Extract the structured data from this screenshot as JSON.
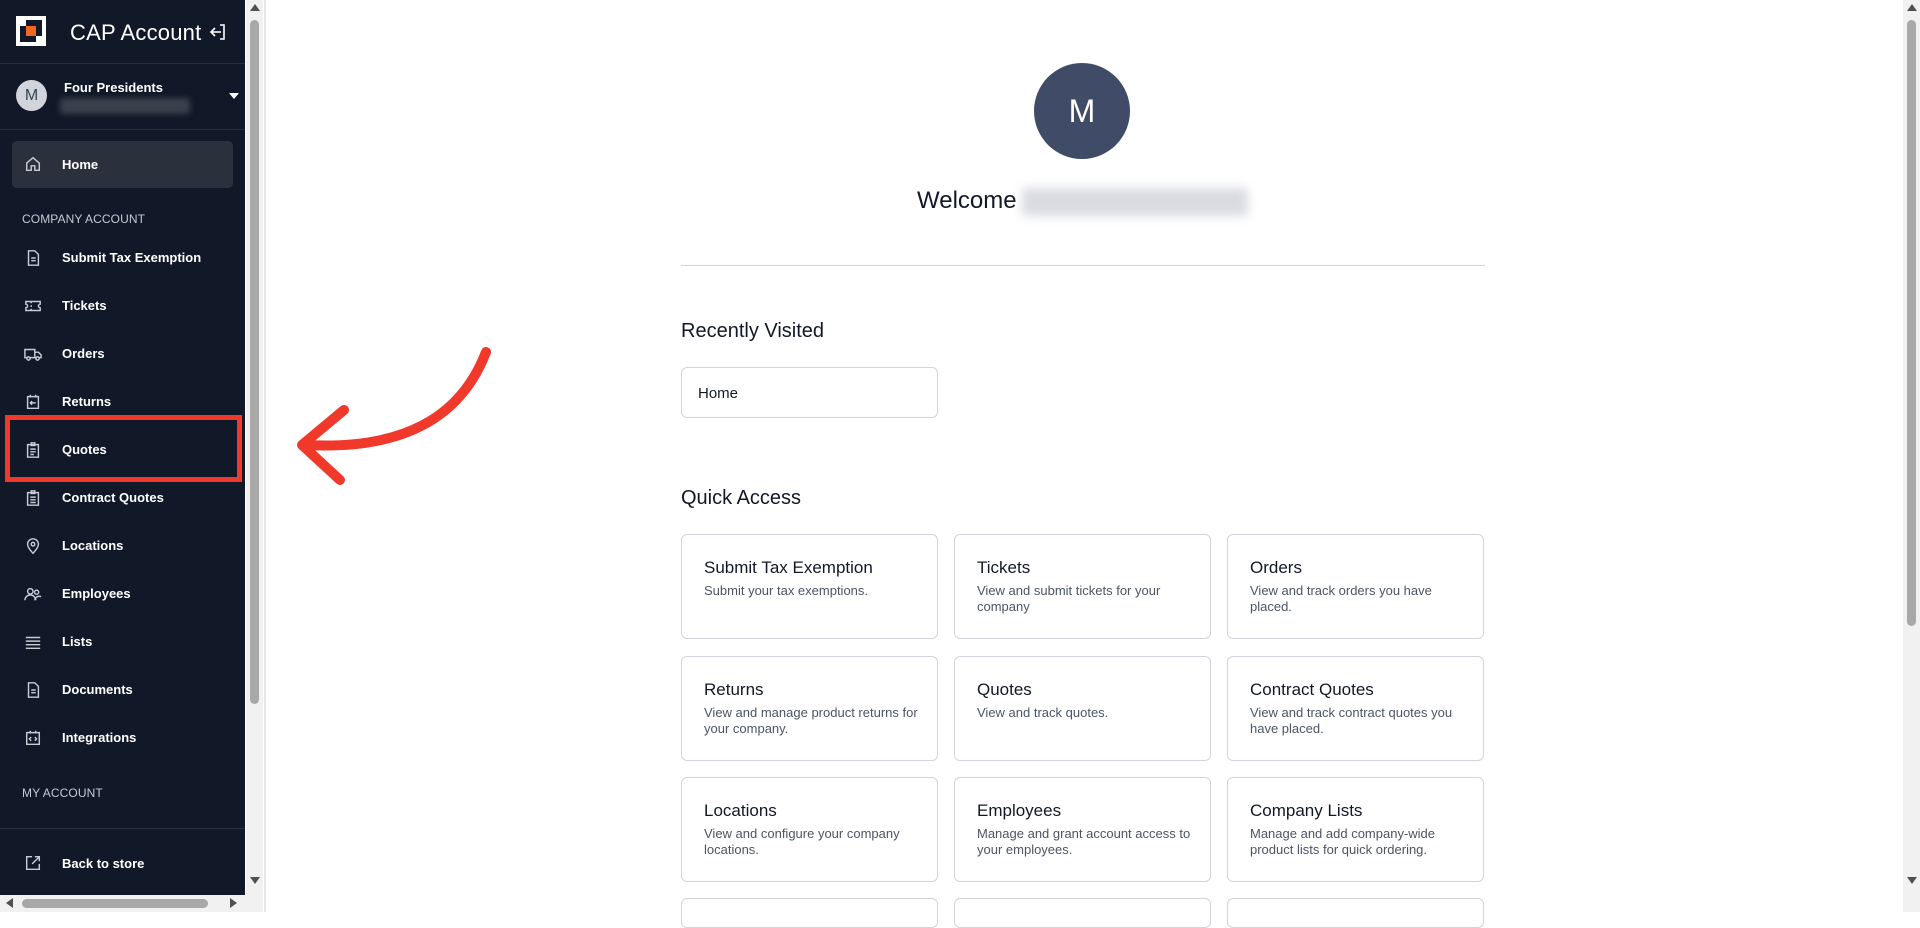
{
  "app": {
    "title": "CAP Account"
  },
  "account": {
    "avatar_initial": "M",
    "name": "Four Presidents"
  },
  "sidebar": {
    "home_label": "Home",
    "company_section": "COMPANY ACCOUNT",
    "items": [
      {
        "label": "Submit Tax Exemption",
        "icon": "document-icon"
      },
      {
        "label": "Tickets",
        "icon": "ticket-icon"
      },
      {
        "label": "Orders",
        "icon": "truck-icon"
      },
      {
        "label": "Returns",
        "icon": "return-icon"
      },
      {
        "label": "Quotes",
        "icon": "clipboard-icon"
      },
      {
        "label": "Contract Quotes",
        "icon": "clipboard-list-icon"
      },
      {
        "label": "Locations",
        "icon": "map-pin-icon"
      },
      {
        "label": "Employees",
        "icon": "users-icon"
      },
      {
        "label": "Lists",
        "icon": "list-icon"
      },
      {
        "label": "Documents",
        "icon": "file-icon"
      },
      {
        "label": "Integrations",
        "icon": "code-box-icon"
      }
    ],
    "my_account_section": "MY ACCOUNT",
    "back_label": "Back to store"
  },
  "main": {
    "avatar_initial": "M",
    "welcome": "Welcome",
    "recently_visited_title": "Recently Visited",
    "recent": [
      "Home"
    ],
    "quick_access_title": "Quick Access",
    "cards": [
      {
        "title": "Submit Tax Exemption",
        "desc": "Submit your tax exemptions."
      },
      {
        "title": "Tickets",
        "desc": "View and submit tickets for your company"
      },
      {
        "title": "Orders",
        "desc": "View and track orders you have placed."
      },
      {
        "title": "Returns",
        "desc": "View and manage product returns for your company."
      },
      {
        "title": "Quotes",
        "desc": "View and track quotes."
      },
      {
        "title": "Contract Quotes",
        "desc": "View and track contract quotes you have placed."
      },
      {
        "title": "Locations",
        "desc": "View and configure your company locations."
      },
      {
        "title": "Employees",
        "desc": "Manage and grant account access to your employees."
      },
      {
        "title": "Company Lists",
        "desc": "Manage and add company-wide product lists for quick ordering."
      }
    ]
  },
  "colors": {
    "sidebar_bg": "#111827",
    "active_item_bg": "#2a313d",
    "highlight": "#f0382b",
    "avatar_bg": "#3f4b67",
    "brand_orange": "#f26522"
  }
}
